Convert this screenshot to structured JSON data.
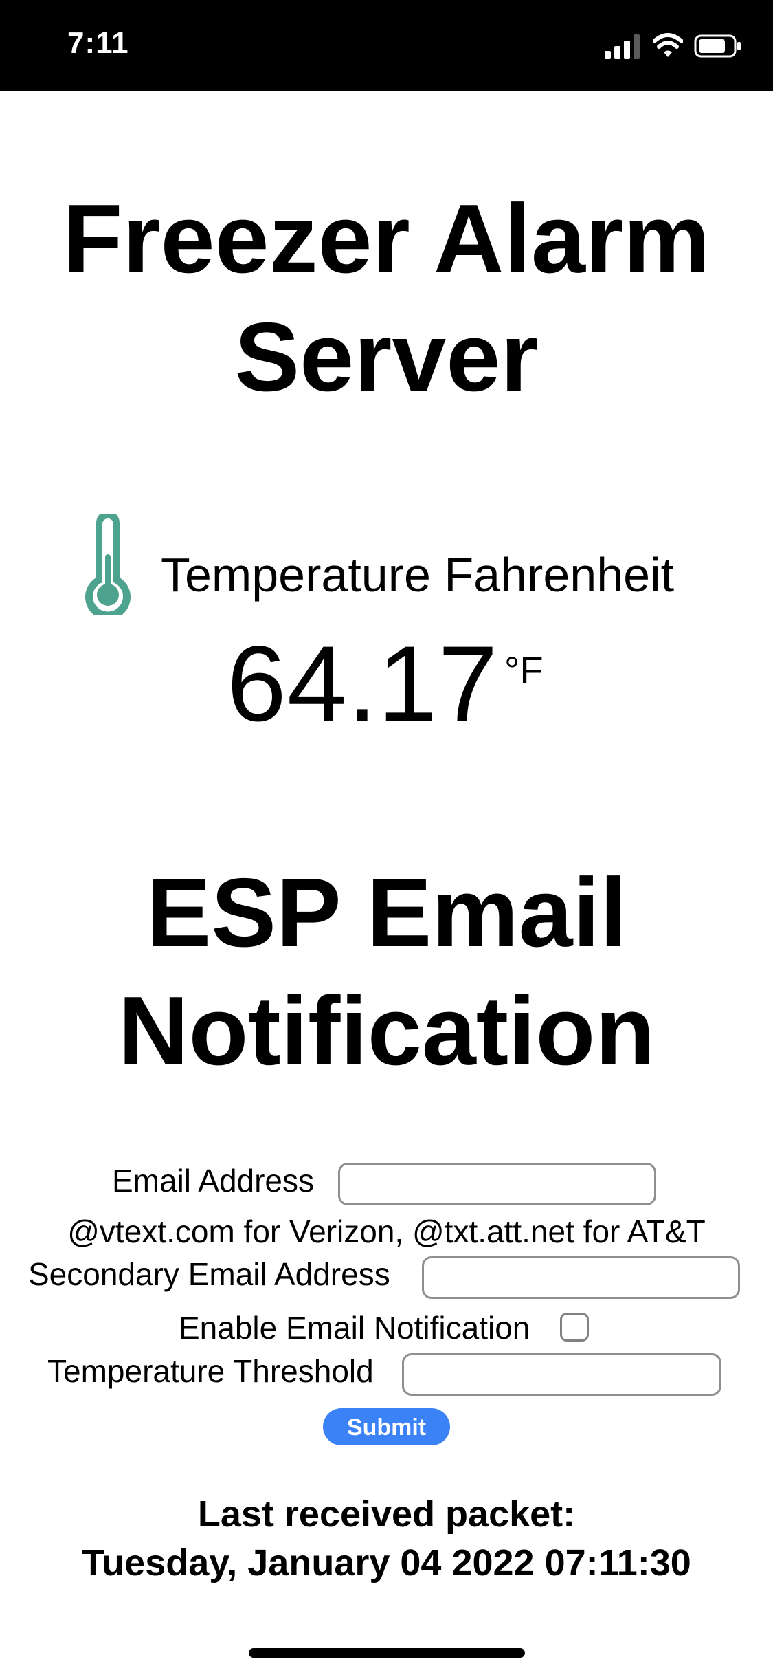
{
  "status_bar": {
    "time": "7:11",
    "icons": [
      "signal-icon",
      "wifi-icon",
      "battery-icon"
    ]
  },
  "page": {
    "title_lines": [
      "Freezer Alarm",
      "Server"
    ]
  },
  "temperature": {
    "icon": "thermometer-icon",
    "label": "Temperature Fahrenheit",
    "value": "64.17",
    "unit": "°F",
    "accent_color": "#4ea38f"
  },
  "email_section": {
    "title_lines": [
      "ESP Email",
      "Notification"
    ],
    "email_label": "Email Address",
    "email_value": "",
    "hint": "@vtext.com for Verizon, @txt.att.net for AT&T",
    "secondary_label": "Secondary Email Address",
    "secondary_value": "",
    "enable_label": "Enable Email Notification",
    "enable_checked": false,
    "threshold_label": "Temperature Threshold",
    "threshold_value": "",
    "submit_label": "Submit",
    "submit_color": "#3b82f6"
  },
  "packet": {
    "label": "Last received packet:",
    "timestamp": "Tuesday, January 04 2022 07:11:30"
  }
}
